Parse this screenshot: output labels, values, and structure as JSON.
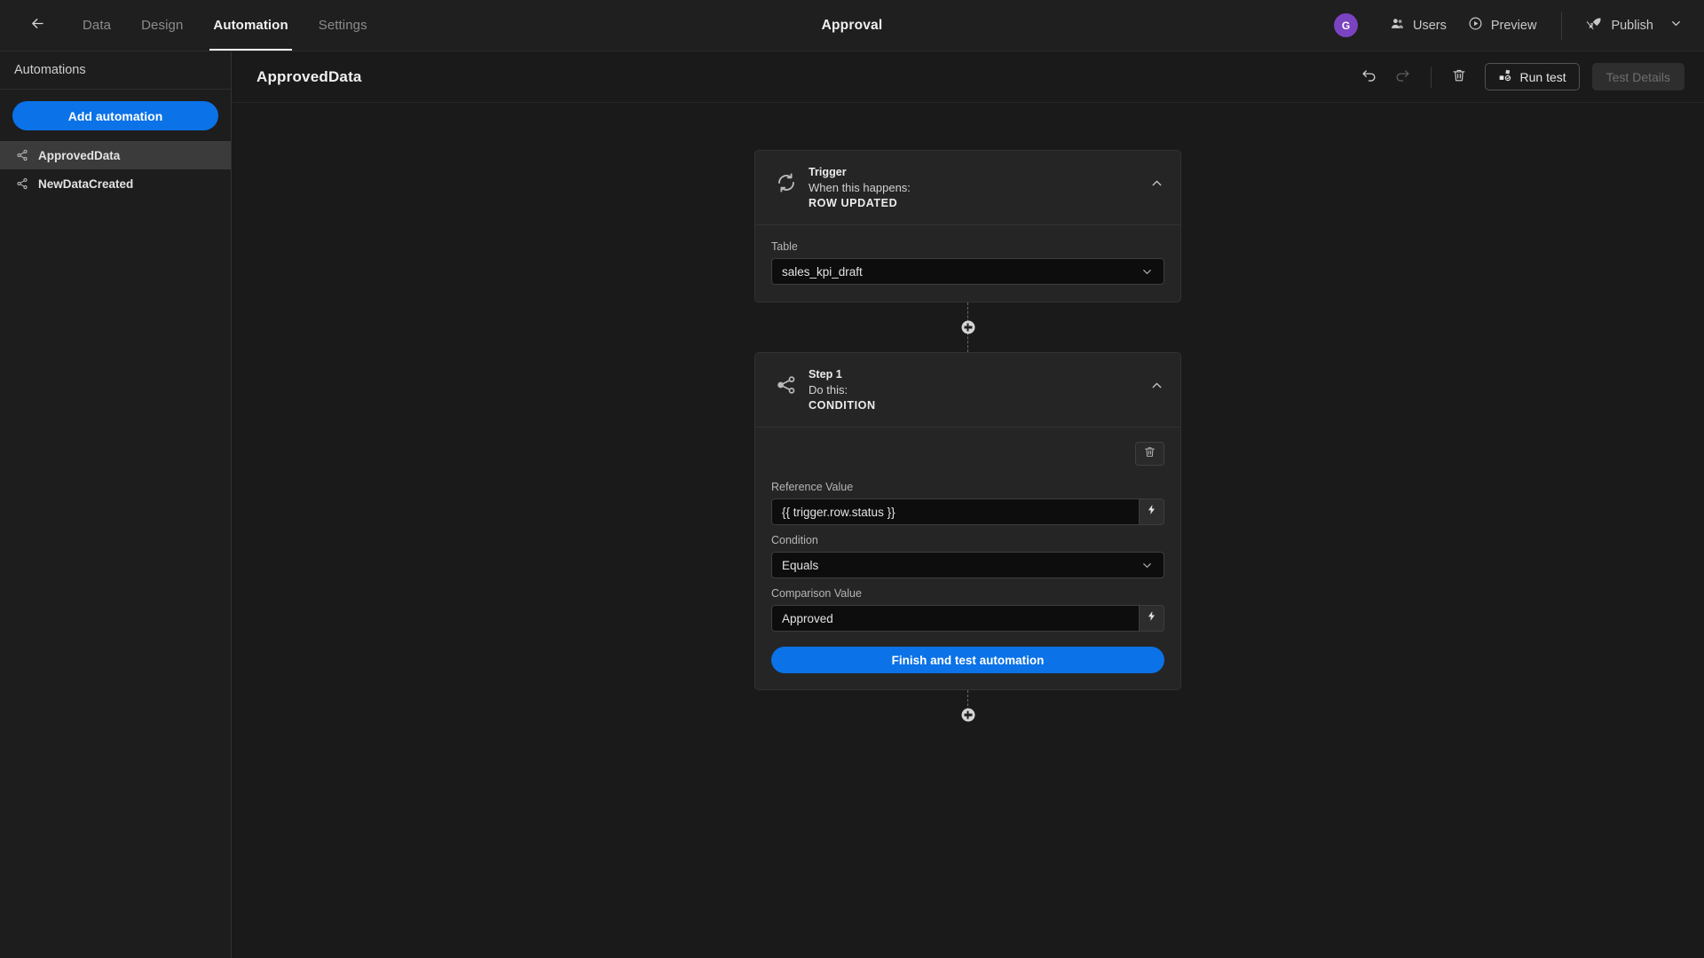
{
  "topbar": {
    "back_icon": "arrow-left-icon",
    "tabs": [
      {
        "label": "Data",
        "active": false
      },
      {
        "label": "Design",
        "active": false
      },
      {
        "label": "Automation",
        "active": true
      },
      {
        "label": "Settings",
        "active": false
      }
    ],
    "app_title": "Approval",
    "avatar_initial": "G",
    "users_label": "Users",
    "users_icon": "users-icon",
    "preview_label": "Preview",
    "preview_icon": "play-circle-icon",
    "publish_label": "Publish",
    "publish_icon": "rocket-icon",
    "publish_chevron_icon": "chevron-down-icon",
    "accent_blue": "#0b72e7",
    "avatar_color": "#7a43c0"
  },
  "sidebar": {
    "heading": "Automations",
    "add_button_label": "Add automation",
    "items": [
      {
        "label": "ApprovedData",
        "icon": "share-nodes-icon",
        "selected": true
      },
      {
        "label": "NewDataCreated",
        "icon": "share-nodes-icon",
        "selected": false
      }
    ]
  },
  "main_header": {
    "title": "ApprovedData",
    "undo_icon": "undo-arrow-icon",
    "redo_icon": "redo-arrow-icon",
    "delete_icon": "trash-icon",
    "run_test_label": "Run test",
    "run_test_icon": "test-blocks-icon",
    "test_details_label": "Test Details",
    "test_details_disabled": true
  },
  "flow": {
    "trigger": {
      "icon": "refresh-cycle-icon",
      "kicker": "Trigger",
      "subtitle": "When this happens:",
      "type": "ROW UPDATED",
      "collapse_icon": "chevron-up-icon",
      "fields": [
        {
          "label": "Table",
          "kind": "select",
          "value": "sales_kpi_draft",
          "chevron_icon": "chevron-down-icon"
        }
      ]
    },
    "step1": {
      "icon": "share-nodes-icon",
      "kicker": "Step 1",
      "subtitle": "Do this:",
      "type": "CONDITION",
      "collapse_icon": "chevron-up-icon",
      "delete_step_icon": "trash-icon",
      "fields": [
        {
          "label": "Reference Value",
          "kind": "input",
          "value": "{{ trigger.row.status }}",
          "action_icon": "lightning-bolt-icon"
        },
        {
          "label": "Condition",
          "kind": "select",
          "value": "Equals",
          "chevron_icon": "chevron-down-icon"
        },
        {
          "label": "Comparison Value",
          "kind": "input",
          "value": "Approved",
          "action_icon": "lightning-bolt-icon"
        }
      ],
      "finish_button_label": "Finish and test automation"
    },
    "add_node_icon": "plus-circle-icon"
  }
}
